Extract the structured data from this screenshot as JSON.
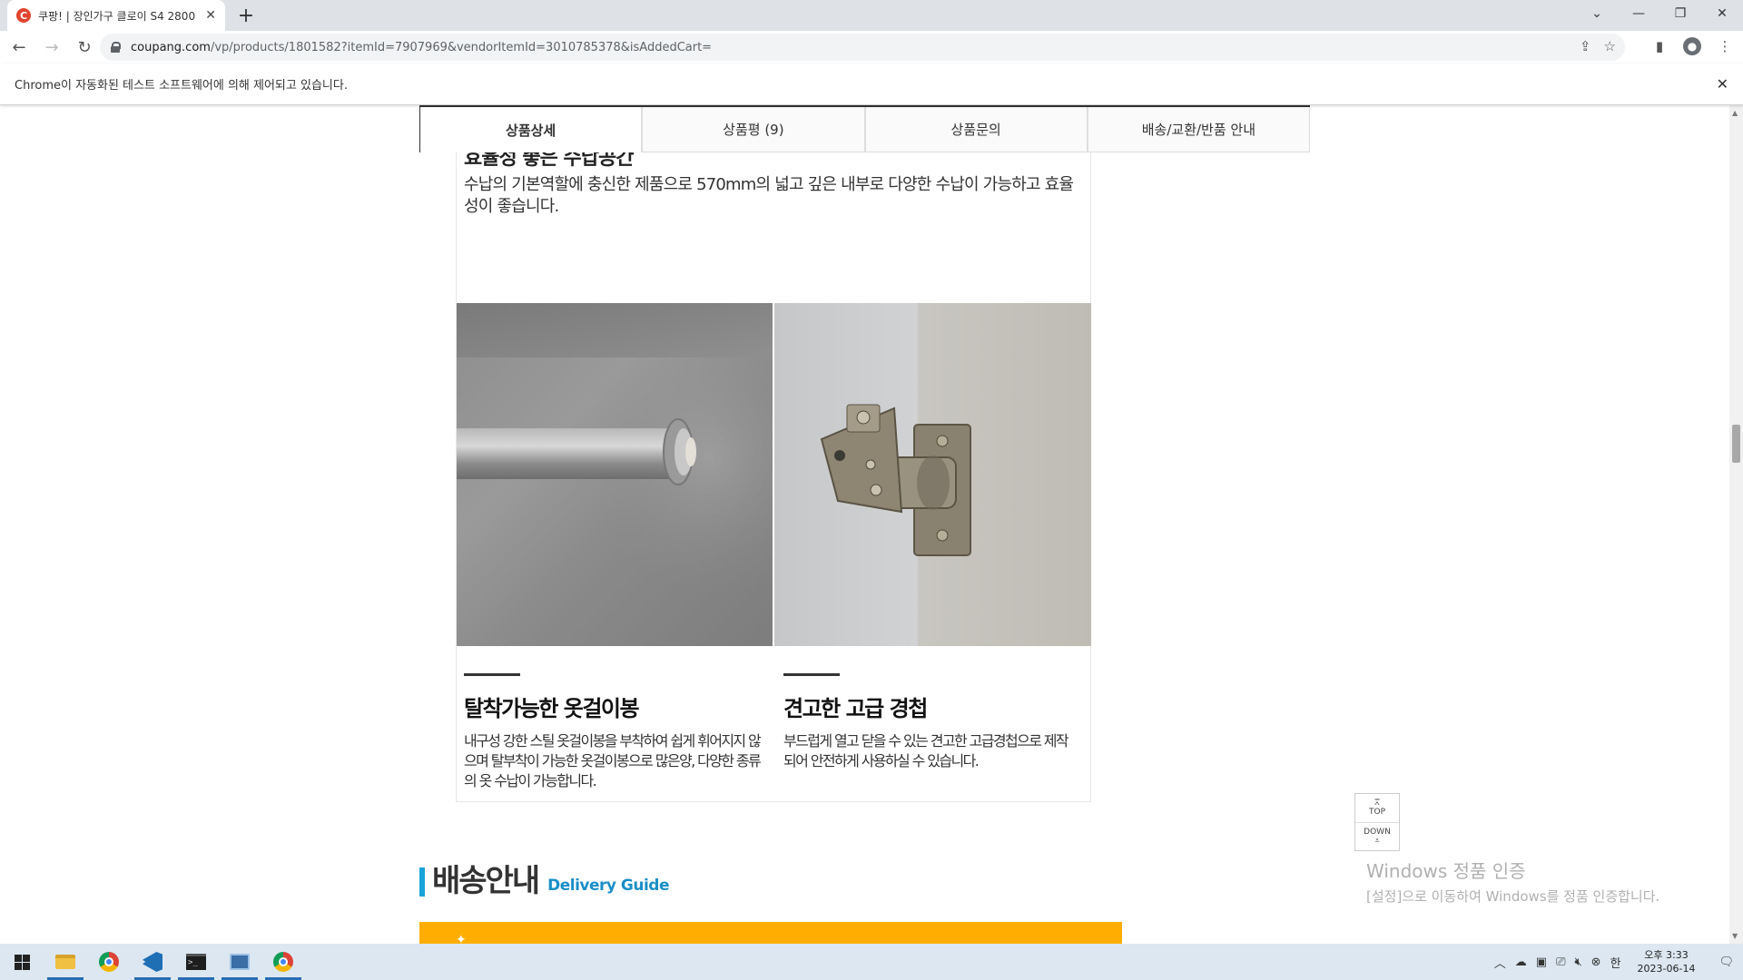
{
  "browser": {
    "tab_title": "쿠팡! | 장인가구 클로이 S4 2800",
    "tab_favicon": "C",
    "new_tab_icon": "+",
    "url_domain": "coupang.com",
    "url_rest": "/vp/products/1801582?itemId=7907969&vendorItemId=3010785378&isAddedCart=",
    "infobar_text": "Chrome이 자동화된 테스트 소프트웨어에 의해 제어되고 있습니다."
  },
  "detail_tabs": [
    {
      "label": "상품상세"
    },
    {
      "label": "상품평 (9)"
    },
    {
      "label": "상품문의"
    },
    {
      "label": "배송/교환/반품 안내"
    }
  ],
  "content": {
    "cut_heading": "효율성 좋은 수납공간",
    "intro_text": "수납의 기본역할에 충신한 제품으로 570mm의 넓고 깊은 내부로 다양한 수납이 가능하고 효율성이 좋습니다.",
    "features": [
      {
        "title": "탈착가능한 옷걸이봉",
        "desc": "내구성 강한 스틸 옷걸이봉을 부착하여 쉽게 휘어지지 않으며 탈부착이 가능한 옷걸이봉으로 많은양, 다양한 종류의 옷 수납이 가능합니다."
      },
      {
        "title": "견고한 고급 경첩",
        "desc": "부드럽게 열고 닫을 수 있는 견고한 고급경첩으로 제작되어 안전하게 사용하실 수 있습니다."
      }
    ]
  },
  "delivery": {
    "title_ko": "배송안내",
    "title_en": "Delivery Guide",
    "accent_color": "#1aa3d8",
    "banner_color": "#ffae00"
  },
  "floating": {
    "top_label": "TOP",
    "down_label": "DOWN"
  },
  "watermark": {
    "title": "Windows 정품 인증",
    "subtitle": "[설정]으로 이동하여 Windows를 정품 인증합니다."
  },
  "taskbar": {
    "time": "오후 3:33",
    "date": "2023-06-14",
    "ime": "한"
  }
}
